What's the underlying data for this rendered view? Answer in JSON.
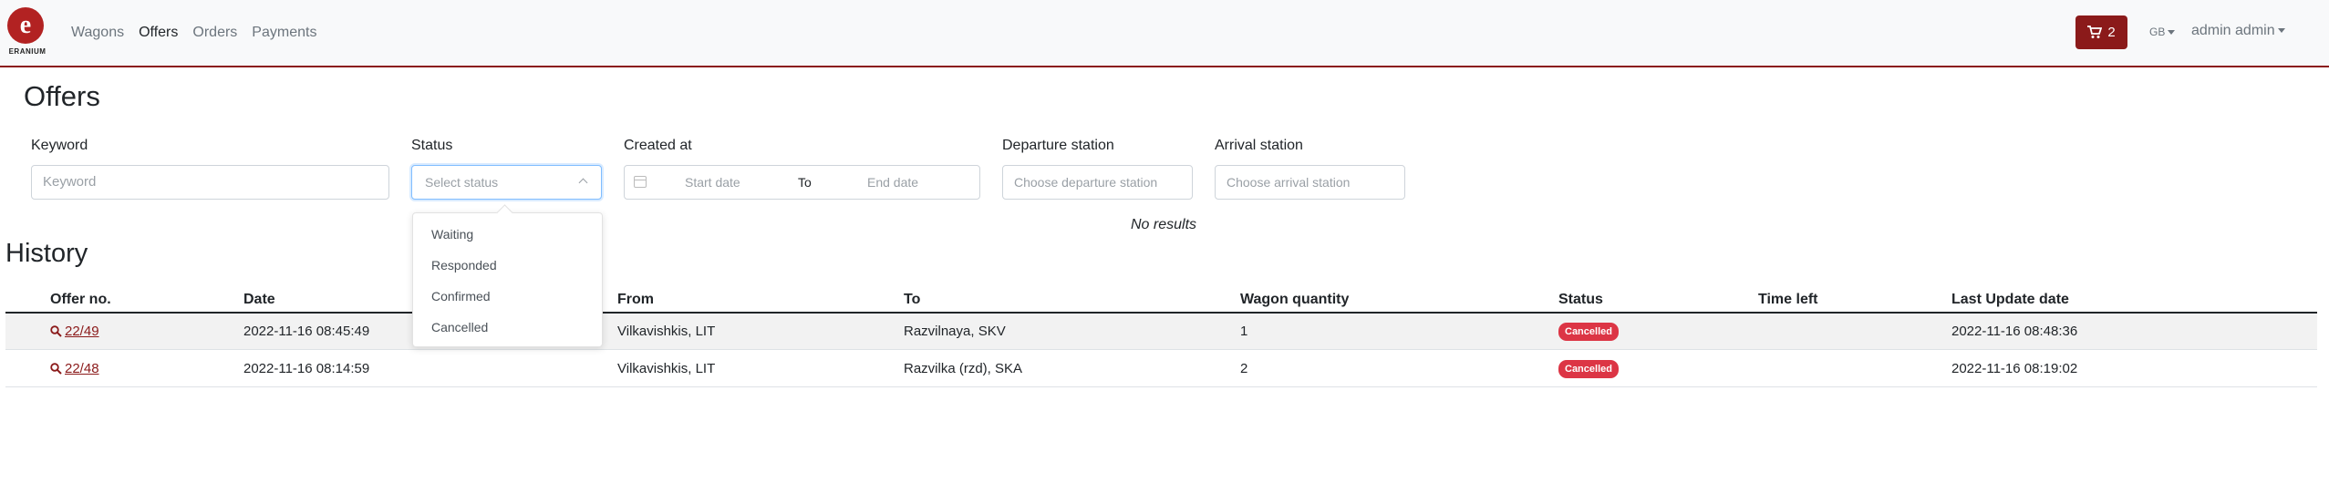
{
  "nav": {
    "logo_text": "ERANIUM",
    "links": [
      "Wagons",
      "Offers",
      "Orders",
      "Payments"
    ],
    "active": "Offers",
    "cart_count": "2",
    "lang": "GB",
    "user": "admin admin"
  },
  "page": {
    "title": "Offers"
  },
  "filters": {
    "keyword": {
      "label": "Keyword",
      "placeholder": "Keyword"
    },
    "status": {
      "label": "Status",
      "placeholder": "Select status",
      "options": [
        "Waiting",
        "Responded",
        "Confirmed",
        "Cancelled"
      ]
    },
    "created_at": {
      "label": "Created at",
      "start": "Start date",
      "to": "To",
      "end": "End date"
    },
    "departure": {
      "label": "Departure station",
      "placeholder": "Choose departure station"
    },
    "arrival": {
      "label": "Arrival station",
      "placeholder": "Choose arrival station"
    }
  },
  "no_results": "No results",
  "history": {
    "title": "History",
    "columns": [
      "Offer no.",
      "Date",
      "From",
      "To",
      "Wagon quantity",
      "Status",
      "Time left",
      "Last Update date"
    ],
    "rows": [
      {
        "offer_no": "22/49",
        "date": "2022-11-16 08:45:49",
        "from": "Vilkavishkis, LIT",
        "to": "Razvilnaya, SKV",
        "qty": "1",
        "status": "Cancelled",
        "time_left": "",
        "updated": "2022-11-16 08:48:36"
      },
      {
        "offer_no": "22/48",
        "date": "2022-11-16 08:14:59",
        "from": "Vilkavishkis, LIT",
        "to": "Razvilka (rzd), SKA",
        "qty": "2",
        "status": "Cancelled",
        "time_left": "",
        "updated": "2022-11-16 08:19:02"
      }
    ]
  },
  "colors": {
    "brand": "#8b1a1a",
    "badge_danger": "#dc3545"
  }
}
